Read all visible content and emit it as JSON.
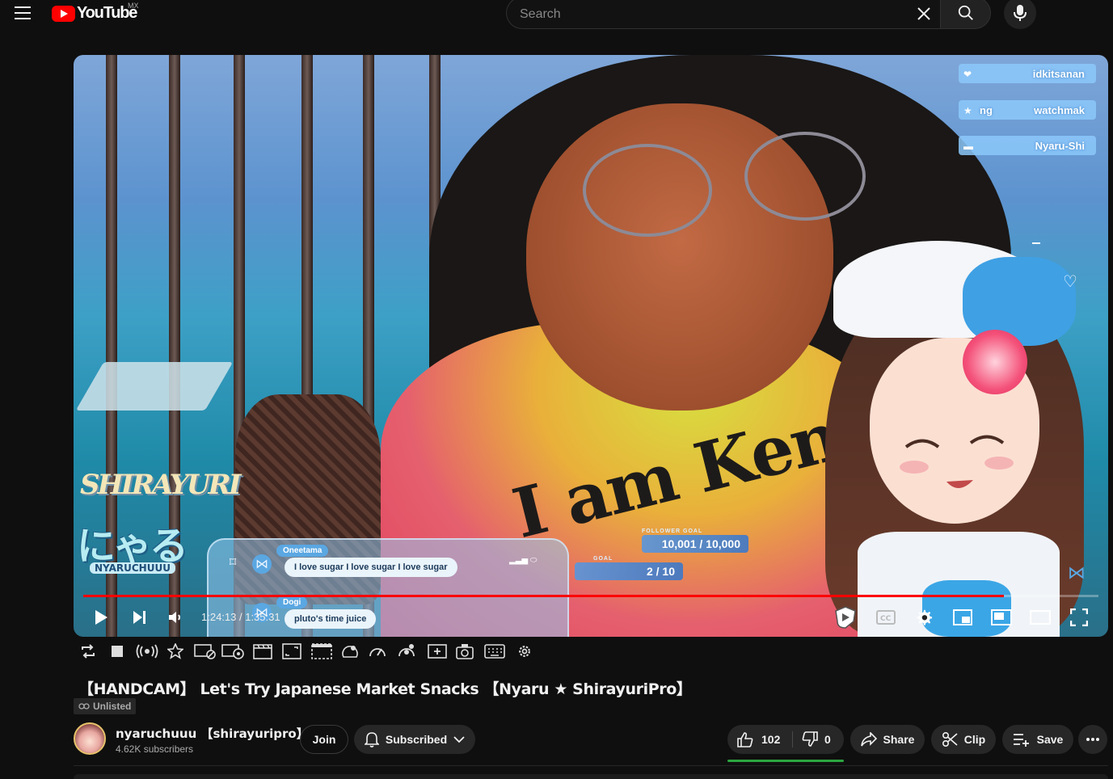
{
  "header": {
    "logo_text": "YouTube",
    "country_code": "MX",
    "search_value": "",
    "search_placeholder": "Search"
  },
  "player": {
    "time_current": "1:24:13",
    "time_total": "1:35:31",
    "time_separator": " / ",
    "progress_fraction": 0.9066
  },
  "overlay": {
    "notifications": [
      {
        "left": "",
        "right": "idkitsanan"
      },
      {
        "left": "ng",
        "right": "watchmak"
      },
      {
        "left": "",
        "right": "Nyaru-Shi"
      }
    ],
    "brand_main": "SHIRAYURI",
    "brand_jp": "にゃる",
    "brand_sub": "NYARUCHUUU",
    "chat": [
      {
        "name": "Oneetama",
        "message": "I love sugar I love sugar I love sugar"
      },
      {
        "name": "Dogi",
        "message": "pluto's time juice"
      }
    ],
    "follower_goal_label": "FOLLOWER GOAL",
    "follower_goal_value": "10,001 / 10,000",
    "goal_label": "GOAL",
    "goal_value": "2 / 10",
    "shirt_text": "I am Ken"
  },
  "video": {
    "title": "【HANDCAM】 Let's Try Japanese Market Snacks 【Nyaru ★ ShirayuriPro】",
    "visibility": "Unlisted"
  },
  "channel": {
    "name": "nyaruchuuu 【shirayuripro】",
    "subscribers": "4.62K subscribers"
  },
  "actions": {
    "join": "Join",
    "subscribed": "Subscribed",
    "likes": "102",
    "dislikes": "0",
    "share": "Share",
    "clip": "Clip",
    "save": "Save"
  },
  "colors": {
    "accent_red": "#ff0000",
    "like_green": "#2ba640",
    "background": "#0f0f0f",
    "pill": "#272727"
  }
}
